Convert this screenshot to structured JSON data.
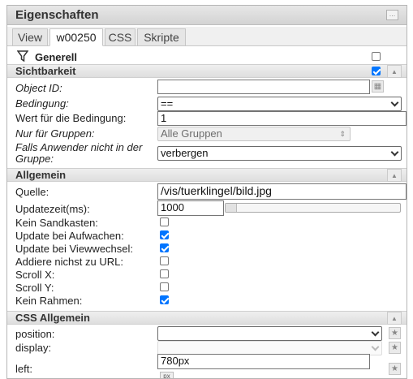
{
  "panel": {
    "title": "Eigenschaften",
    "collapse_icon": "…"
  },
  "tabs": [
    "View",
    "w00250",
    "CSS",
    "Skripte"
  ],
  "generell": {
    "label": "Generell"
  },
  "sichtbarkeit": {
    "title": "Sichtbarkeit",
    "checked": true,
    "object_id": {
      "label": "Object ID:",
      "value": ""
    },
    "condition": {
      "label": "Bedingung:",
      "value": "=="
    },
    "condition_value": {
      "label": "Wert für die Bedingung:",
      "value": "1"
    },
    "groups": {
      "label": "Nur für Gruppen:",
      "value": "Alle Gruppen"
    },
    "action": {
      "label": "Falls Anwender nicht in der Gruppe:",
      "value": "verbergen"
    }
  },
  "allgemein": {
    "title": "Allgemein",
    "source": {
      "label": "Quelle:",
      "value": "/vis/tuerklingel/bild.jpg"
    },
    "refresh": {
      "label": "Updatezeit(ms):",
      "value": "1000"
    },
    "flags": [
      {
        "label": "Kein Sandkasten:",
        "checked": false
      },
      {
        "label": "Update bei Aufwachen:",
        "checked": true
      },
      {
        "label": "Update bei Viewwechsel:",
        "checked": true
      },
      {
        "label": "Addiere nichst zu URL:",
        "checked": false
      },
      {
        "label": "Scroll X:",
        "checked": false
      },
      {
        "label": "Scroll Y:",
        "checked": false
      },
      {
        "label": "Kein Rahmen:",
        "checked": true
      }
    ]
  },
  "css": {
    "title": "CSS Allgemein",
    "position": {
      "label": "position:",
      "value": ""
    },
    "display": {
      "label": "display:",
      "value": ""
    },
    "left": {
      "label": "left:",
      "value": "780px",
      "unit": "px"
    }
  },
  "colors": {
    "accent": "#0075ff",
    "header": "#d3d3d3"
  }
}
